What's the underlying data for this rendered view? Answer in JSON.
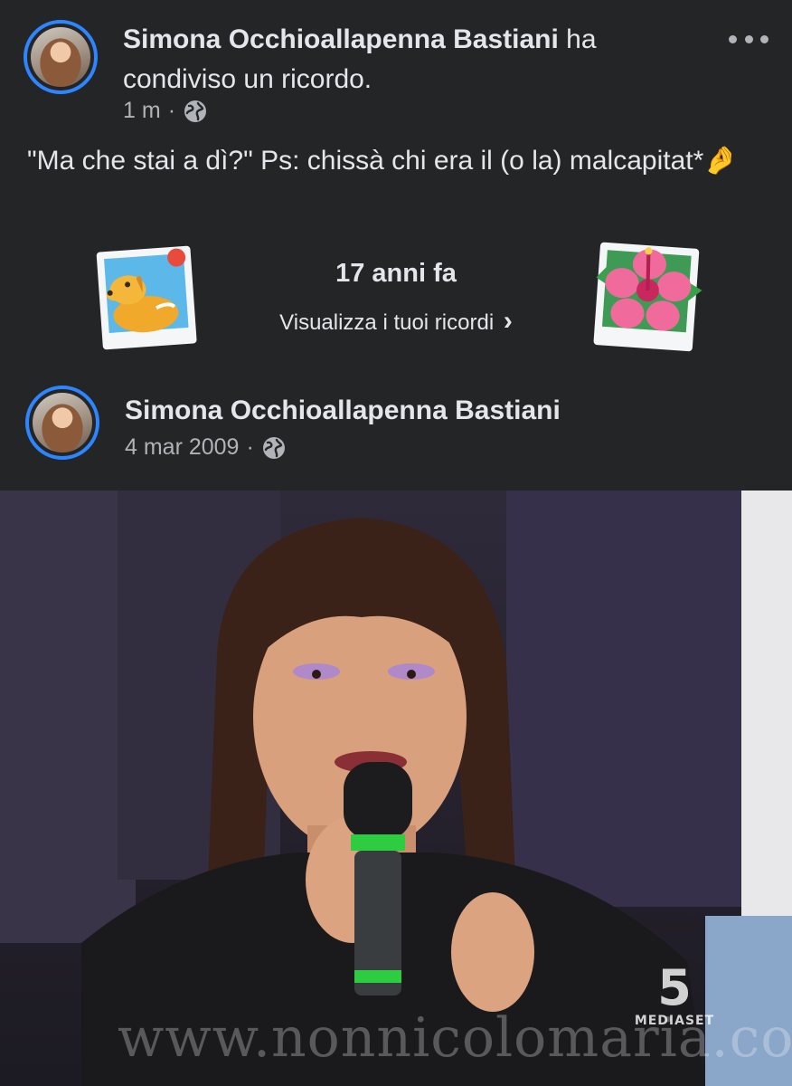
{
  "shared_post": {
    "author": "Simona Occhioallapenna Bastiani",
    "action": "ha condiviso un ricordo.",
    "time": "1 m",
    "separator": "·",
    "privacy_icon": "globe-icon",
    "more_icon": "more-options-icon",
    "text": "\"Ma che stai a dì?\" Ps: chissà chi era il (o la) malcapitat*🤌"
  },
  "memory_banner": {
    "title": "17 anni fa",
    "link": "Visualizza i tuoi ricordi",
    "chevron": "›",
    "left_icon": "dog-photo-icon",
    "right_icon": "hibiscus-photo-icon"
  },
  "original_post": {
    "author": "Simona Occhioallapenna Bastiani",
    "date": "4 mar 2009",
    "separator": "·",
    "privacy_icon": "globe-icon"
  },
  "photo": {
    "watermark": "www.nonnicolomaria.com",
    "channel_number": "5",
    "channel_label": "MEDIASET"
  },
  "colors": {
    "background": "#242526",
    "avatar_ring": "#2d86ff",
    "text_primary": "#e4e6eb",
    "text_secondary": "#b0b3b8"
  }
}
